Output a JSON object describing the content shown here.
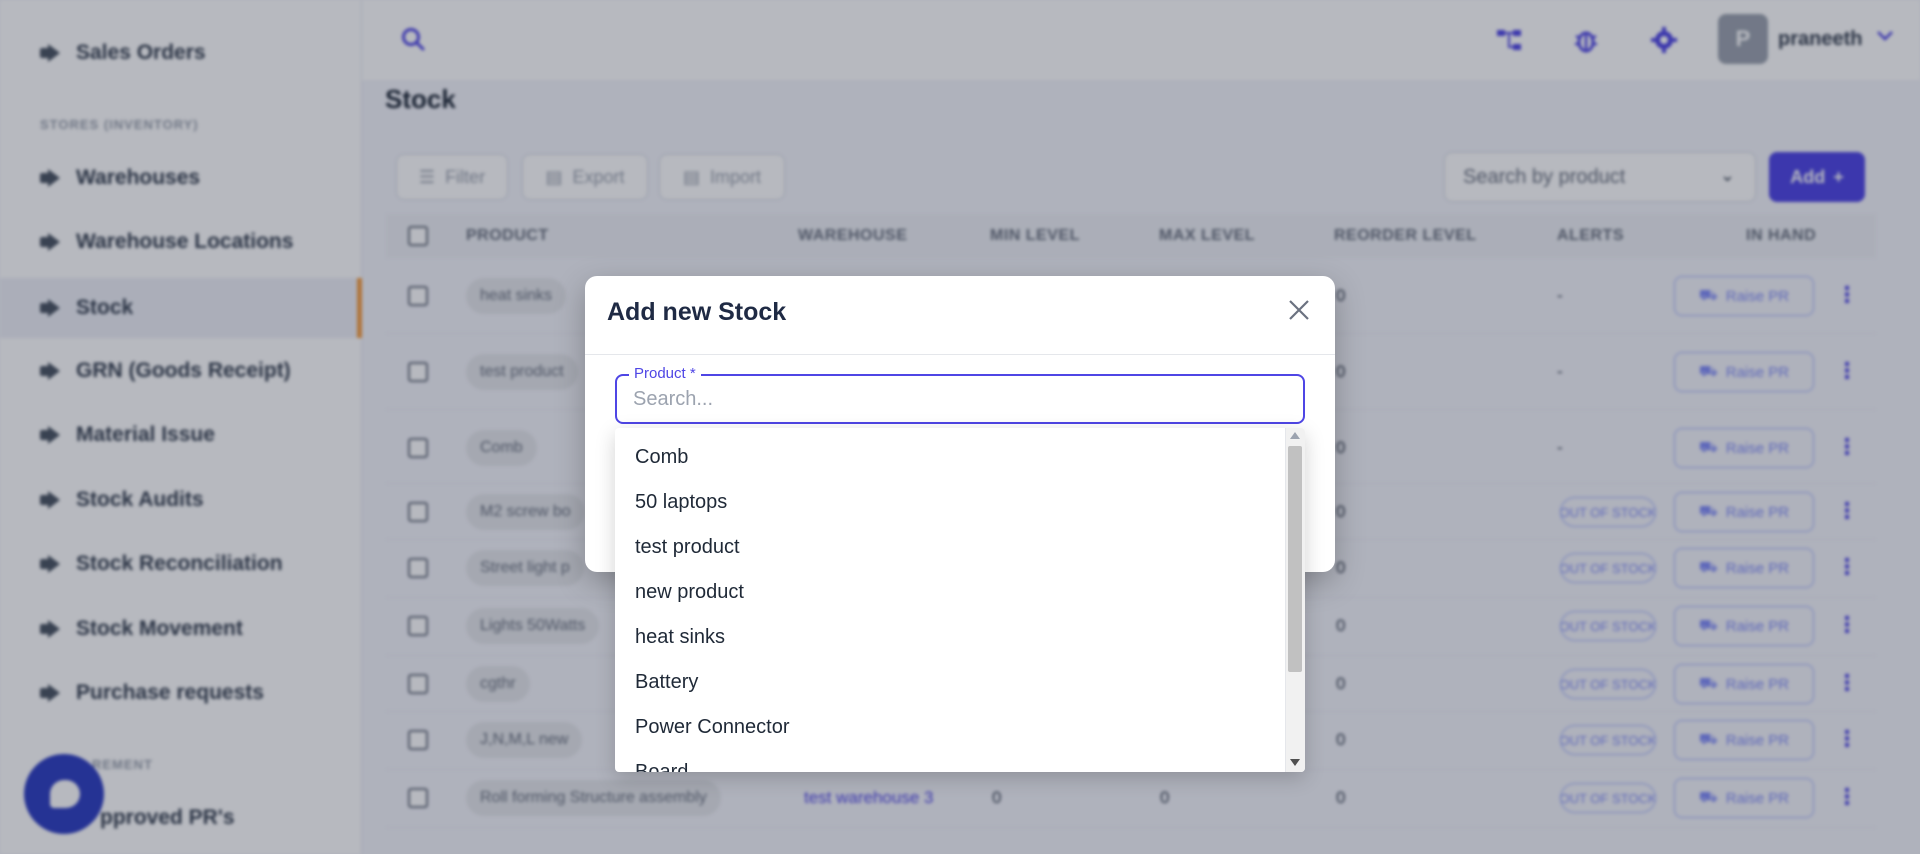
{
  "sidebar": {
    "items": [
      {
        "label": "Sales Orders"
      },
      {
        "label": "Warehouses"
      },
      {
        "label": "Warehouse Locations"
      },
      {
        "label": "Stock"
      },
      {
        "label": "GRN (Goods Receipt)"
      },
      {
        "label": "Material Issue"
      },
      {
        "label": "Stock Audits"
      },
      {
        "label": "Stock Reconciliation"
      },
      {
        "label": "Stock Movement"
      },
      {
        "label": "Purchase requests"
      },
      {
        "label": "pproved PR's"
      }
    ],
    "section_stores": "STORES (INVENTORY)",
    "section_procurement": "REMENT",
    "active_item": "Stock"
  },
  "topbar": {
    "avatar_initial": "P",
    "username": "praneeth"
  },
  "page": {
    "title": "Stock",
    "filter_label": "Filter",
    "export_label": "Export",
    "import_label": "Import",
    "search_placeholder": "Search by product",
    "add_label": "Add"
  },
  "table": {
    "headers": [
      "PRODUCT",
      "WAREHOUSE",
      "MIN LEVEL",
      "MAX LEVEL",
      "REORDER LEVEL",
      "ALERTS",
      "IN HAND"
    ],
    "rows": [
      {
        "product": "heat sinks",
        "warehouse": "",
        "min": "",
        "max": "",
        "reorder": "0",
        "alert": "-",
        "raise": "Raise PR"
      },
      {
        "product": "test product",
        "warehouse": "",
        "min": "",
        "max": "",
        "reorder": "0",
        "alert": "-",
        "raise": "Raise PR"
      },
      {
        "product": "Comb",
        "warehouse": "",
        "min": "",
        "max": "",
        "reorder": "0",
        "alert": "-",
        "raise": "Raise PR"
      },
      {
        "product": "M2 screw bo",
        "warehouse": "",
        "min": "",
        "max": "",
        "reorder": "0",
        "alert": "OUT OF STOCK",
        "raise": "Raise PR"
      },
      {
        "product": "Street light p",
        "warehouse": "",
        "min": "",
        "max": "",
        "reorder": "0",
        "alert": "OUT OF STOCK",
        "raise": "Raise PR"
      },
      {
        "product": "Lights 50Watts",
        "warehouse": "",
        "min": "",
        "max": "",
        "reorder": "0",
        "alert": "OUT OF STOCK",
        "raise": "Raise PR"
      },
      {
        "product": "cgthr",
        "warehouse": "",
        "min": "",
        "max": "",
        "reorder": "0",
        "alert": "OUT OF STOCK",
        "raise": "Raise PR"
      },
      {
        "product": "J,N,M,L new",
        "warehouse": "",
        "min": "",
        "max": "",
        "reorder": "0",
        "alert": "OUT OF STOCK",
        "raise": "Raise PR"
      },
      {
        "product": "Roll forming Structure assembly",
        "warehouse": "test warehouse 3",
        "min": "0",
        "max": "0",
        "reorder": "0",
        "alert": "OUT OF STOCK",
        "raise": "Raise PR"
      }
    ]
  },
  "modal": {
    "title": "Add new Stock",
    "field_label": "Product *",
    "field_placeholder": "Search...",
    "options": [
      "Comb",
      "50 laptops",
      "test product",
      "new product",
      "heat sinks",
      "Battery",
      "Power Connector",
      "Board"
    ]
  },
  "colors": {
    "accent": "#4f46e5",
    "active_indicator": "#f59e42",
    "chat_button": "#2f3fc2"
  }
}
